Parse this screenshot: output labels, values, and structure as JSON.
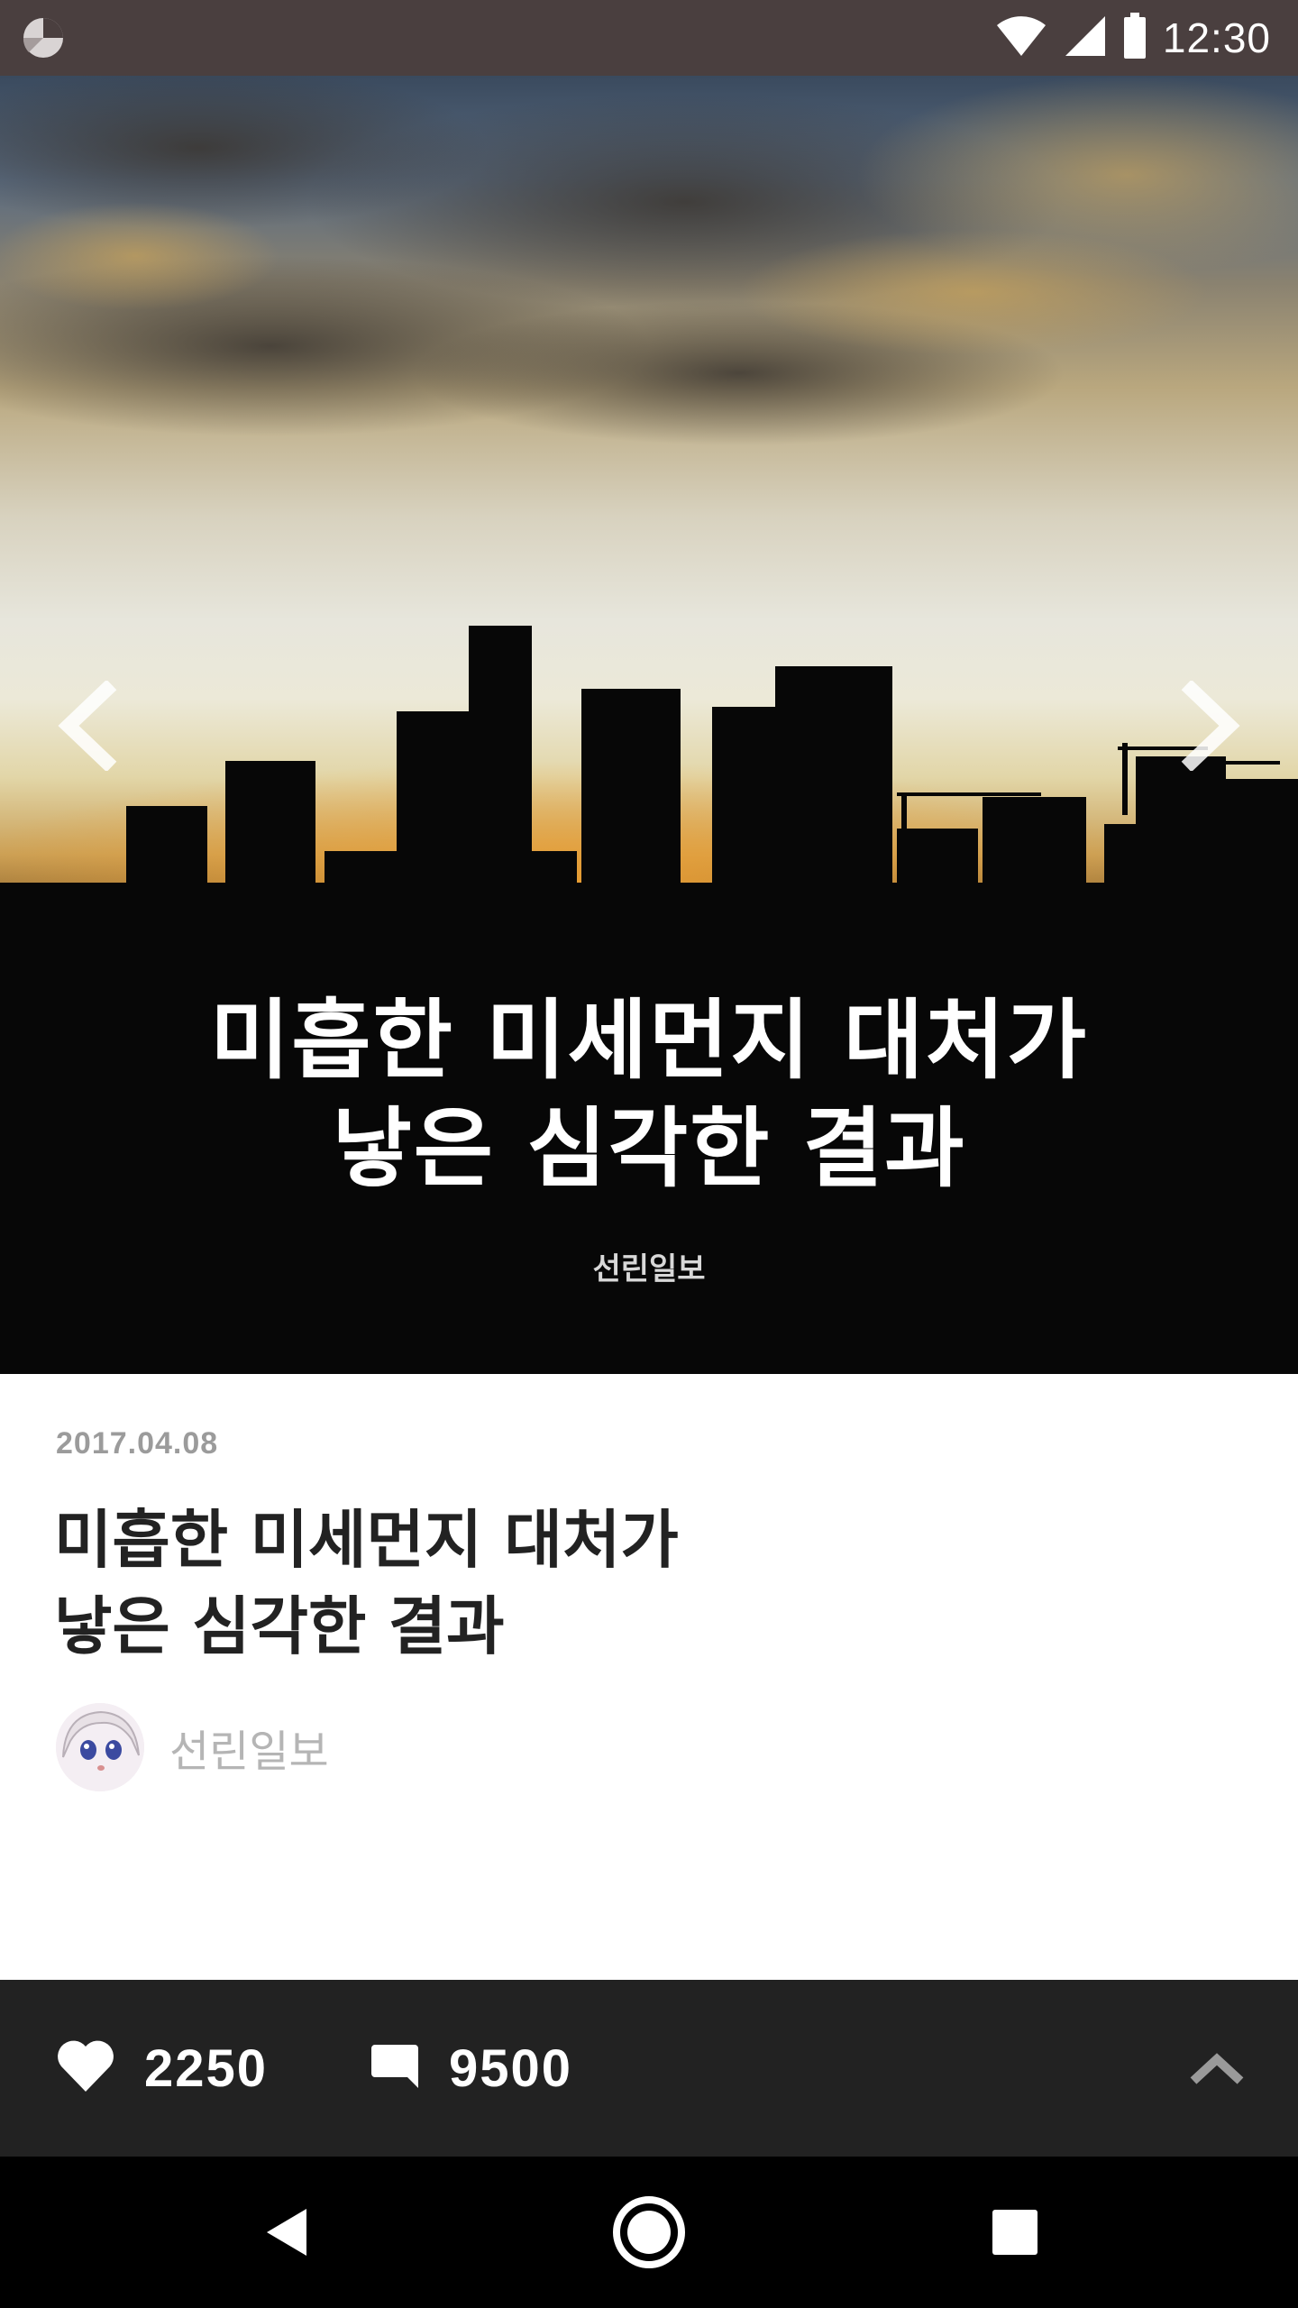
{
  "status_bar": {
    "time": "12:30",
    "icons": [
      "app-icon",
      "wifi-icon",
      "signal-icon",
      "battery-icon"
    ]
  },
  "hero": {
    "title_lines": [
      "미흡한 미세먼지 대처가",
      "낳은 심각한 결과"
    ],
    "source": "선린일보",
    "icons": [
      "chevron-left-icon",
      "chevron-right-icon"
    ]
  },
  "article": {
    "date": "2017.04.08",
    "title_lines": [
      "미흡한 미세먼지 대처가",
      "낳은 심각한 결과"
    ],
    "author": "선린일보"
  },
  "actions": {
    "likes": "2250",
    "comments": "9500",
    "icons": [
      "heart-icon",
      "comment-icon",
      "chevron-up-icon"
    ]
  },
  "nav_bar": {
    "icons": [
      "back-icon",
      "home-icon",
      "recents-icon"
    ]
  },
  "colors": {
    "status_bar": "#4a3f3f",
    "action_bar": "#222222",
    "nav_bar": "#000000",
    "date_text": "#9b9b9b",
    "author_text": "#b5b5b5"
  }
}
